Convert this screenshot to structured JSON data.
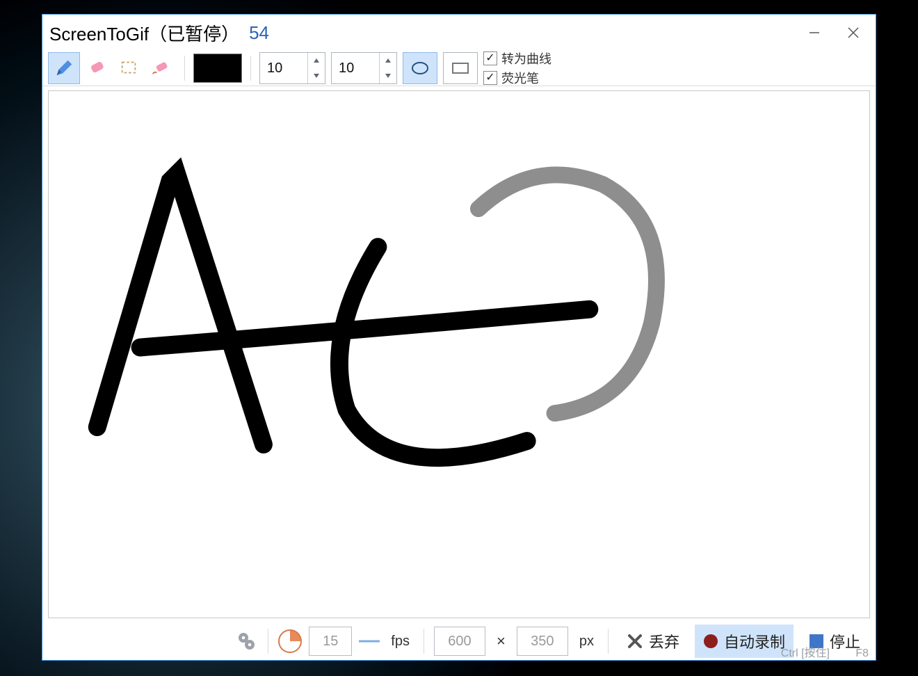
{
  "title": {
    "app_name": "ScreenToGif（已暂停）",
    "frame_count": "54"
  },
  "toolbar": {
    "stroke_width_value": "10",
    "eraser_width_value": "10",
    "color_hex": "#000000",
    "checkbox_curve_label": "转为曲线",
    "checkbox_highlighter_label": "荧光笔",
    "checkbox_curve_checked": true,
    "checkbox_highlighter_checked": true
  },
  "status": {
    "fps_value": "15",
    "fps_label": "fps",
    "width_value": "600",
    "height_value": "350",
    "size_unit": "px",
    "times_symbol": "×",
    "discard_label": "丢弃",
    "auto_record_label": "自动录制",
    "stop_label": "停止",
    "ctrl_hint": "Ctrl [按住]",
    "hotkey_hint": "F8"
  }
}
